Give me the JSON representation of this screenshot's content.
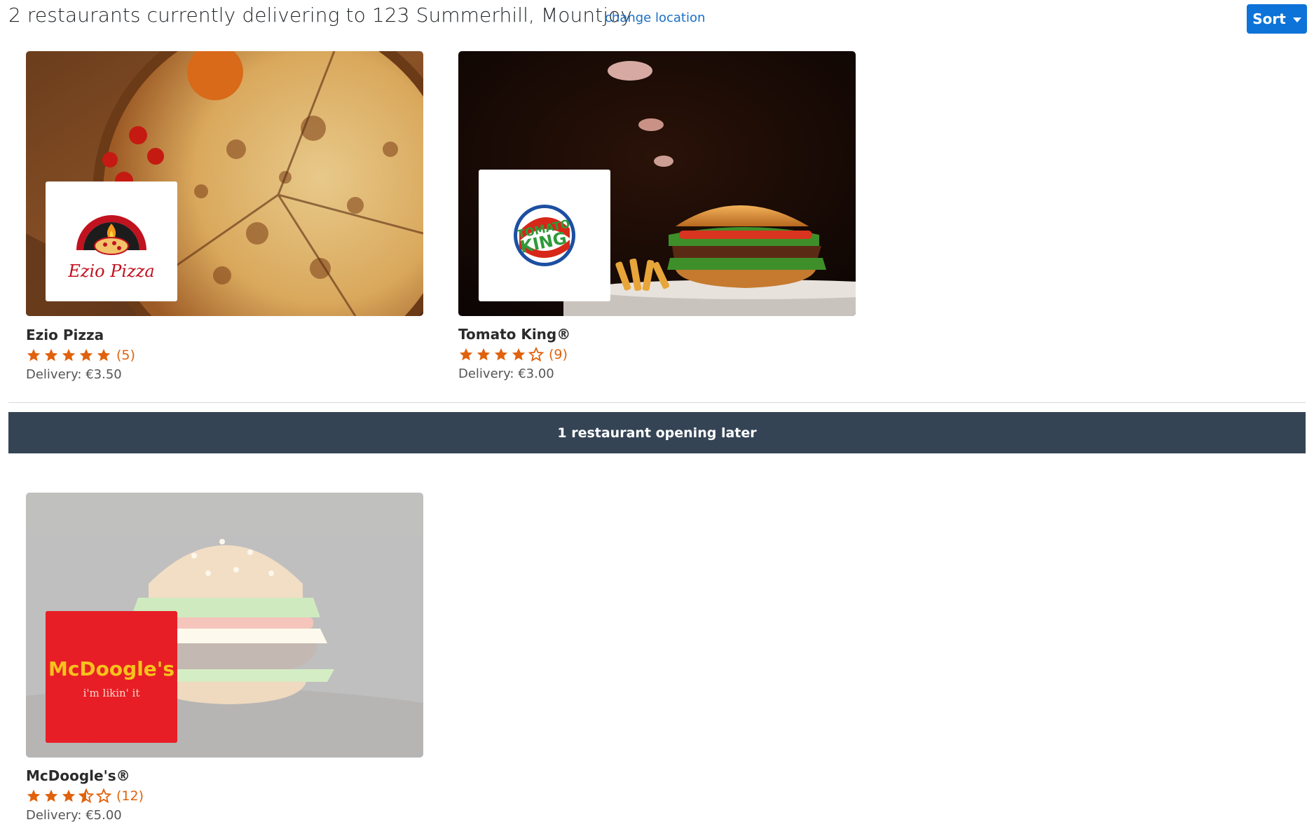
{
  "header": {
    "heading": "2 restaurants currently delivering to 123 Summerhill, Mountjoy",
    "change_location": "change location",
    "sort_label": "Sort"
  },
  "delivering": [
    {
      "name": "Ezio Pizza",
      "rating": 5,
      "review_count": "(5)",
      "delivery": "Delivery: €3.50",
      "logo_text": "Ezio Pizza"
    },
    {
      "name": "Tomato King®",
      "rating": 4,
      "review_count": "(9)",
      "delivery": "Delivery: €3.00",
      "logo_text_top": "TOMATO",
      "logo_text_bottom": "KING"
    }
  ],
  "banner": {
    "text": "1 restaurant opening later"
  },
  "opening_later": [
    {
      "name": "McDoogle's®",
      "rating": 3.5,
      "review_count": "(12)",
      "delivery": "Delivery: €5.00",
      "logo_text": "McDoogle's",
      "logo_tagline": "i'm likin' it"
    }
  ],
  "colors": {
    "accent": "#0d73d8",
    "link": "#1a6fc4",
    "star": "#e0620d",
    "banner": "#344455",
    "mcdoogles_red": "#e81e26",
    "mcdoogles_yellow": "#f7c21c"
  },
  "icons": [
    "star-icon",
    "half-star-icon",
    "empty-star-icon",
    "caret-down-icon"
  ]
}
